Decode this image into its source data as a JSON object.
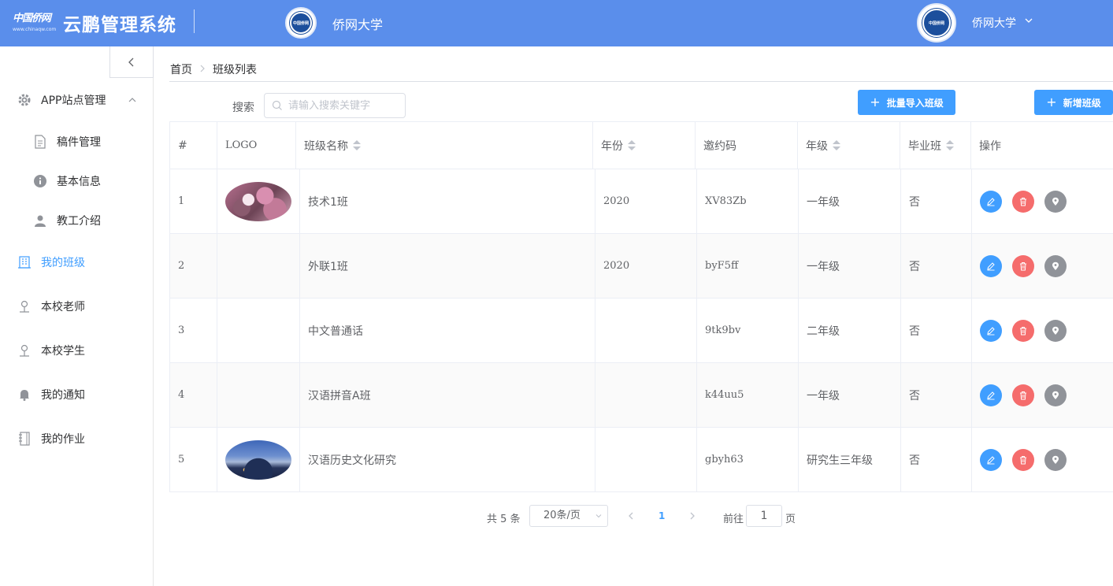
{
  "header": {
    "brand_text": "中国侨网",
    "brand_sub": "www.chinaqw.com",
    "system_title": "云鹏管理系统",
    "school_name": "侨网大学",
    "user_name": "侨网大学",
    "badge_text": "中国侨网"
  },
  "sidebar": {
    "items": [
      {
        "label": "APP站点管理"
      },
      {
        "label": "稿件管理"
      },
      {
        "label": "基本信息"
      },
      {
        "label": "教工介绍"
      },
      {
        "label": "我的班级"
      },
      {
        "label": "本校老师"
      },
      {
        "label": "本校学生"
      },
      {
        "label": "我的通知"
      },
      {
        "label": "我的作业"
      }
    ]
  },
  "breadcrumb": {
    "home": "首页",
    "current": "班级列表"
  },
  "toolbar": {
    "search_label": "搜索",
    "search_placeholder": "请输入搜索关键字",
    "import_label": "批量导入班级",
    "add_label": "新增班级"
  },
  "table": {
    "columns": [
      "#",
      "LOGO",
      "班级名称",
      "年份",
      "邀约码",
      "年级",
      "毕业班",
      "操作"
    ],
    "rows": [
      {
        "index": "1",
        "logo": "cherry",
        "name": "技术1班",
        "year": "2020",
        "code": "XV83Zb",
        "grade": "一年级",
        "graduate": "否"
      },
      {
        "index": "2",
        "logo": "",
        "name": "外联1班",
        "year": "2020",
        "code": "byF5ff",
        "grade": "一年级",
        "graduate": "否"
      },
      {
        "index": "3",
        "logo": "",
        "name": "中文普通话",
        "year": "",
        "code": "9tk9bv",
        "grade": "二年级",
        "graduate": "否"
      },
      {
        "index": "4",
        "logo": "",
        "name": "汉语拼音A班",
        "year": "",
        "code": "k44uu5",
        "grade": "一年级",
        "graduate": "否"
      },
      {
        "index": "5",
        "logo": "night",
        "name": "汉语历史文化研究",
        "year": "",
        "code": "gbyh63",
        "grade": "研究生三年级",
        "graduate": "否"
      }
    ]
  },
  "pagination": {
    "total": "共 5 条",
    "page_size": "20条/页",
    "current_page": "1",
    "goto_label": "前往",
    "goto_value": "1",
    "page_suffix": "页"
  },
  "colors": {
    "header_bg": "#5a8eeb",
    "primary": "#409eff",
    "danger": "#f56c6c",
    "info": "#909399"
  }
}
